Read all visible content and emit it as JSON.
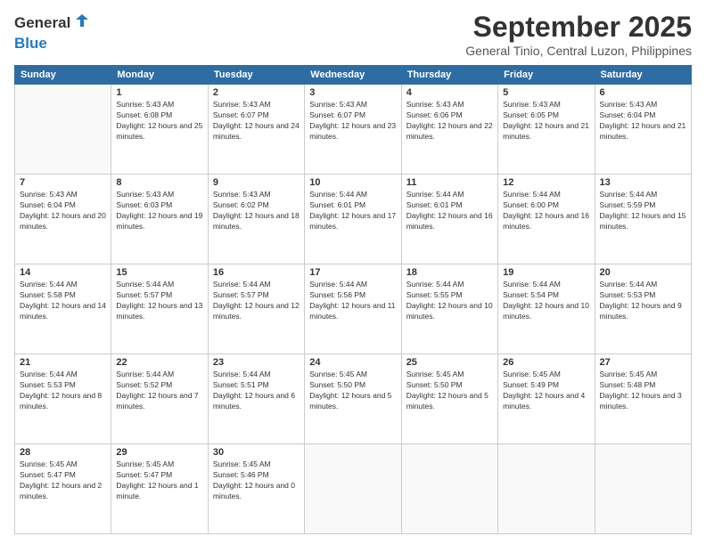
{
  "header": {
    "logo": {
      "general": "General",
      "blue": "Blue",
      "tagline": ""
    },
    "month": "September 2025",
    "location": "General Tinio, Central Luzon, Philippines"
  },
  "weekdays": [
    "Sunday",
    "Monday",
    "Tuesday",
    "Wednesday",
    "Thursday",
    "Friday",
    "Saturday"
  ],
  "weeks": [
    [
      {
        "day": "",
        "empty": true
      },
      {
        "day": "1",
        "sunrise": "Sunrise: 5:43 AM",
        "sunset": "Sunset: 6:08 PM",
        "daylight": "Daylight: 12 hours and 25 minutes."
      },
      {
        "day": "2",
        "sunrise": "Sunrise: 5:43 AM",
        "sunset": "Sunset: 6:07 PM",
        "daylight": "Daylight: 12 hours and 24 minutes."
      },
      {
        "day": "3",
        "sunrise": "Sunrise: 5:43 AM",
        "sunset": "Sunset: 6:07 PM",
        "daylight": "Daylight: 12 hours and 23 minutes."
      },
      {
        "day": "4",
        "sunrise": "Sunrise: 5:43 AM",
        "sunset": "Sunset: 6:06 PM",
        "daylight": "Daylight: 12 hours and 22 minutes."
      },
      {
        "day": "5",
        "sunrise": "Sunrise: 5:43 AM",
        "sunset": "Sunset: 6:05 PM",
        "daylight": "Daylight: 12 hours and 21 minutes."
      },
      {
        "day": "6",
        "sunrise": "Sunrise: 5:43 AM",
        "sunset": "Sunset: 6:04 PM",
        "daylight": "Daylight: 12 hours and 21 minutes."
      }
    ],
    [
      {
        "day": "7",
        "sunrise": "Sunrise: 5:43 AM",
        "sunset": "Sunset: 6:04 PM",
        "daylight": "Daylight: 12 hours and 20 minutes."
      },
      {
        "day": "8",
        "sunrise": "Sunrise: 5:43 AM",
        "sunset": "Sunset: 6:03 PM",
        "daylight": "Daylight: 12 hours and 19 minutes."
      },
      {
        "day": "9",
        "sunrise": "Sunrise: 5:43 AM",
        "sunset": "Sunset: 6:02 PM",
        "daylight": "Daylight: 12 hours and 18 minutes."
      },
      {
        "day": "10",
        "sunrise": "Sunrise: 5:44 AM",
        "sunset": "Sunset: 6:01 PM",
        "daylight": "Daylight: 12 hours and 17 minutes."
      },
      {
        "day": "11",
        "sunrise": "Sunrise: 5:44 AM",
        "sunset": "Sunset: 6:01 PM",
        "daylight": "Daylight: 12 hours and 16 minutes."
      },
      {
        "day": "12",
        "sunrise": "Sunrise: 5:44 AM",
        "sunset": "Sunset: 6:00 PM",
        "daylight": "Daylight: 12 hours and 16 minutes."
      },
      {
        "day": "13",
        "sunrise": "Sunrise: 5:44 AM",
        "sunset": "Sunset: 5:59 PM",
        "daylight": "Daylight: 12 hours and 15 minutes."
      }
    ],
    [
      {
        "day": "14",
        "sunrise": "Sunrise: 5:44 AM",
        "sunset": "Sunset: 5:58 PM",
        "daylight": "Daylight: 12 hours and 14 minutes."
      },
      {
        "day": "15",
        "sunrise": "Sunrise: 5:44 AM",
        "sunset": "Sunset: 5:57 PM",
        "daylight": "Daylight: 12 hours and 13 minutes."
      },
      {
        "day": "16",
        "sunrise": "Sunrise: 5:44 AM",
        "sunset": "Sunset: 5:57 PM",
        "daylight": "Daylight: 12 hours and 12 minutes."
      },
      {
        "day": "17",
        "sunrise": "Sunrise: 5:44 AM",
        "sunset": "Sunset: 5:56 PM",
        "daylight": "Daylight: 12 hours and 11 minutes."
      },
      {
        "day": "18",
        "sunrise": "Sunrise: 5:44 AM",
        "sunset": "Sunset: 5:55 PM",
        "daylight": "Daylight: 12 hours and 10 minutes."
      },
      {
        "day": "19",
        "sunrise": "Sunrise: 5:44 AM",
        "sunset": "Sunset: 5:54 PM",
        "daylight": "Daylight: 12 hours and 10 minutes."
      },
      {
        "day": "20",
        "sunrise": "Sunrise: 5:44 AM",
        "sunset": "Sunset: 5:53 PM",
        "daylight": "Daylight: 12 hours and 9 minutes."
      }
    ],
    [
      {
        "day": "21",
        "sunrise": "Sunrise: 5:44 AM",
        "sunset": "Sunset: 5:53 PM",
        "daylight": "Daylight: 12 hours and 8 minutes."
      },
      {
        "day": "22",
        "sunrise": "Sunrise: 5:44 AM",
        "sunset": "Sunset: 5:52 PM",
        "daylight": "Daylight: 12 hours and 7 minutes."
      },
      {
        "day": "23",
        "sunrise": "Sunrise: 5:44 AM",
        "sunset": "Sunset: 5:51 PM",
        "daylight": "Daylight: 12 hours and 6 minutes."
      },
      {
        "day": "24",
        "sunrise": "Sunrise: 5:45 AM",
        "sunset": "Sunset: 5:50 PM",
        "daylight": "Daylight: 12 hours and 5 minutes."
      },
      {
        "day": "25",
        "sunrise": "Sunrise: 5:45 AM",
        "sunset": "Sunset: 5:50 PM",
        "daylight": "Daylight: 12 hours and 5 minutes."
      },
      {
        "day": "26",
        "sunrise": "Sunrise: 5:45 AM",
        "sunset": "Sunset: 5:49 PM",
        "daylight": "Daylight: 12 hours and 4 minutes."
      },
      {
        "day": "27",
        "sunrise": "Sunrise: 5:45 AM",
        "sunset": "Sunset: 5:48 PM",
        "daylight": "Daylight: 12 hours and 3 minutes."
      }
    ],
    [
      {
        "day": "28",
        "sunrise": "Sunrise: 5:45 AM",
        "sunset": "Sunset: 5:47 PM",
        "daylight": "Daylight: 12 hours and 2 minutes."
      },
      {
        "day": "29",
        "sunrise": "Sunrise: 5:45 AM",
        "sunset": "Sunset: 5:47 PM",
        "daylight": "Daylight: 12 hours and 1 minute."
      },
      {
        "day": "30",
        "sunrise": "Sunrise: 5:45 AM",
        "sunset": "Sunset: 5:46 PM",
        "daylight": "Daylight: 12 hours and 0 minutes."
      },
      {
        "day": "",
        "empty": true
      },
      {
        "day": "",
        "empty": true
      },
      {
        "day": "",
        "empty": true
      },
      {
        "day": "",
        "empty": true
      }
    ]
  ]
}
